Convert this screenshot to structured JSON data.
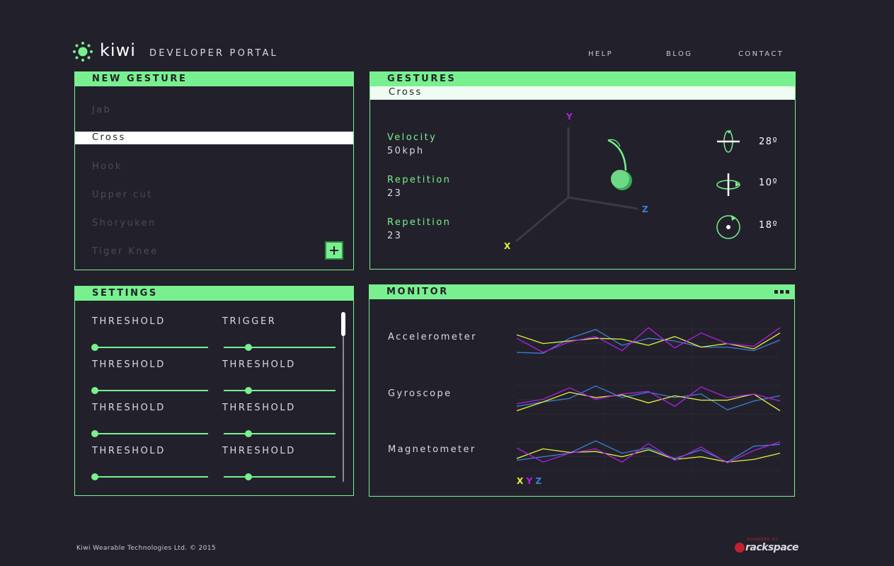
{
  "brand": {
    "name": "kiwi",
    "subtitle": "DEVELOPER PORTAL"
  },
  "nav": [
    "HELP",
    "BLOG",
    "CONTACT"
  ],
  "new_gesture": {
    "title": "NEW GESTURE",
    "items": [
      "Jab",
      "Cross",
      "Hook",
      "Upper cut",
      "Shoryuken",
      "Tiger Knee"
    ],
    "selected": "Cross",
    "add_icon": "plus-icon"
  },
  "gestures": {
    "title": "GESTURES",
    "selected": "Cross",
    "metrics": [
      {
        "label": "Velocity",
        "value": "50kph"
      },
      {
        "label": "Repetition",
        "value": "23"
      },
      {
        "label": "Repetition",
        "value": "23"
      }
    ],
    "axes": {
      "x": "X",
      "y": "Y",
      "z": "Z"
    },
    "rotations": [
      {
        "icon": "rotate-horizontal-icon",
        "value": "28º"
      },
      {
        "icon": "rotate-vertical-icon",
        "value": "10º"
      },
      {
        "icon": "rotate-circular-icon",
        "value": "18º"
      }
    ]
  },
  "settings": {
    "title": "SETTINGS",
    "rows": [
      {
        "left": {
          "label": "THRESHOLD",
          "level": 0.0
        },
        "right": {
          "label": "TRIGGER",
          "level": 0.21
        }
      },
      {
        "left": {
          "label": "THRESHOLD",
          "level": 0.0
        },
        "right": {
          "label": "THRESHOLD",
          "level": 0.21
        }
      },
      {
        "left": {
          "label": "THRESHOLD",
          "level": 0.0
        },
        "right": {
          "label": "THRESHOLD",
          "level": 0.21
        }
      },
      {
        "left": {
          "label": "THRESHOLD",
          "level": 0.0
        },
        "right": {
          "label": "THRESHOLD",
          "level": 0.21
        }
      }
    ]
  },
  "monitor": {
    "title": "MONITOR",
    "menu_icon": "more-icon",
    "legend": [
      "X",
      "Y",
      "Z"
    ],
    "colors": {
      "x": "#e6f23c",
      "y": "#b21ee6",
      "z": "#3d7fd6"
    },
    "sensors": [
      {
        "label": "Accelerometer",
        "x": [
          32,
          22,
          25,
          28,
          27,
          20,
          30,
          18,
          22,
          16,
          34
        ],
        "y": [
          28,
          12,
          24,
          30,
          14,
          40,
          17,
          34,
          22,
          19,
          40
        ],
        "z": [
          12,
          11,
          28,
          38,
          20,
          28,
          25,
          18,
          18,
          14,
          26
        ]
      },
      {
        "label": "Gyroscope",
        "x": [
          10,
          20,
          31,
          25,
          28,
          19,
          27,
          22,
          22,
          29,
          10
        ],
        "y": [
          18,
          23,
          36,
          23,
          29,
          32,
          15,
          37,
          25,
          29,
          21
        ],
        "z": [
          15,
          20,
          24,
          38,
          25,
          31,
          25,
          29,
          11,
          21,
          27
        ]
      },
      {
        "label": "Magnetometer",
        "x": [
          20,
          31,
          27,
          28,
          22,
          30,
          19,
          22,
          16,
          19,
          26
        ],
        "y": [
          32,
          16,
          26,
          31,
          16,
          37,
          18,
          33,
          15,
          29,
          39
        ],
        "z": [
          18,
          22,
          26,
          40,
          26,
          32,
          20,
          30,
          16,
          34,
          36
        ]
      }
    ]
  },
  "footer": {
    "copyright": "Kiwi Wearable Technologies Ltd. © 2015",
    "powered_by": "POWERED BY",
    "partner": "rackspace"
  }
}
